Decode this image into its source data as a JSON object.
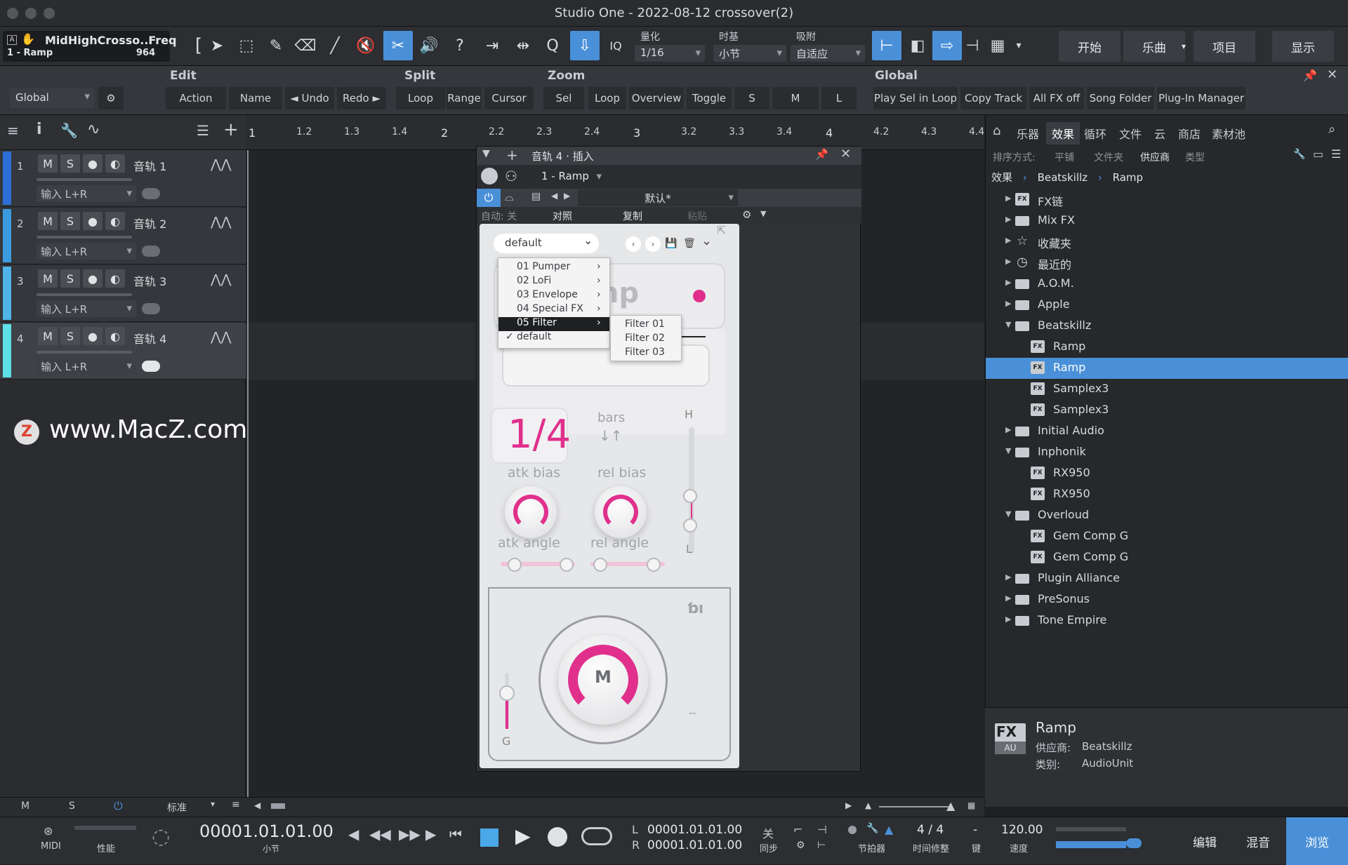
{
  "window": {
    "title": "Studio One - 2022-08-12 crossover(2)"
  },
  "toolbar": {
    "track_name": "MidHighCrosso..Freq",
    "track_sub": "1 - Ramp",
    "track_value": "964",
    "iq": "IQ",
    "quantize_label": "量化",
    "quantize_value": "1/16",
    "timebase_label": "时基",
    "timebase_value": "小节",
    "snap_label": "吸附",
    "snap_value": "自适应",
    "nav": [
      "开始",
      "乐曲",
      "项目",
      "显示"
    ]
  },
  "macro": {
    "groups": [
      "Edit",
      "Split",
      "Zoom",
      "Global"
    ],
    "global_select": "Global",
    "buttons": [
      "Action",
      "Name",
      "◄ Undo",
      "Redo ►",
      "Loop",
      "Range",
      "Cursor",
      "Sel",
      "Loop",
      "Overview",
      "Toggle",
      "S",
      "M",
      "L",
      "Play Sel in Loop",
      "Copy Track",
      "All FX off",
      "Song Folder",
      "Plug-In Manager"
    ]
  },
  "tracks": [
    {
      "num": "1",
      "name": "音轨 1",
      "input": "输入 L+R",
      "color": "#2d6fd6"
    },
    {
      "num": "2",
      "name": "音轨 2",
      "input": "输入 L+R",
      "color": "#3b9be0"
    },
    {
      "num": "3",
      "name": "音轨 3",
      "input": "输入 L+R",
      "color": "#4fb4e8"
    },
    {
      "num": "4",
      "name": "音轨 4",
      "input": "输入 L+R",
      "color": "#5fe0e8"
    }
  ],
  "track_buttons": {
    "m": "M",
    "s": "S"
  },
  "ruler": {
    "ticks": [
      "1",
      "1.2",
      "1.3",
      "1.4",
      "2",
      "2.2",
      "2.3",
      "2.4",
      "3",
      "3.2",
      "3.3",
      "3.4",
      "4",
      "4.2",
      "4.3",
      "4.4"
    ]
  },
  "watermark": {
    "text": "www.MacZ.com",
    "badge": "Z"
  },
  "plugin": {
    "title": "音轨 4 · 插入",
    "slot": "1 - Ramp",
    "preset": "默认*",
    "auto": "自动: 关",
    "compare": "对照",
    "copy": "复制",
    "paste": "粘贴",
    "preset_dropdown": "default",
    "menu_items": [
      "01 Pumper",
      "02 LoFi",
      "03 Envelope",
      "04 Special FX",
      "05 Filter",
      "default"
    ],
    "submenu_items": [
      "Filter 01",
      "Filter 02",
      "Filter 03"
    ],
    "rate": "1/4",
    "bars": "bars",
    "bars_arrows": "↓↑",
    "atk_bias": "atk bias",
    "rel_bias": "rel bias",
    "atk_angle": "atk angle",
    "rel_angle": "rel angle",
    "h": "H",
    "l": "L",
    "g": "G",
    "m": "M",
    "dash": "--",
    "logo_partial": "np"
  },
  "browser": {
    "tabs": [
      "乐器",
      "效果",
      "循环",
      "文件",
      "云",
      "商店",
      "素材池"
    ],
    "active_tab": "效果",
    "sort_label": "排序方式:",
    "sort_options": [
      "平铺",
      "文件夹",
      "供应商",
      "类型"
    ],
    "breadcrumb": [
      "效果",
      "Beatskillz",
      "Ramp"
    ],
    "items": [
      {
        "label": "FX链",
        "kind": "fx",
        "indent": 0,
        "arrow": "▶"
      },
      {
        "label": "Mix FX",
        "kind": "folder",
        "indent": 0,
        "arrow": "▶"
      },
      {
        "label": "收藏夹",
        "kind": "star",
        "indent": 0,
        "arrow": "▶"
      },
      {
        "label": "最近的",
        "kind": "clock",
        "indent": 0,
        "arrow": "▶"
      },
      {
        "label": "A.O.M.",
        "kind": "folder",
        "indent": 0,
        "arrow": "▶"
      },
      {
        "label": "Apple",
        "kind": "folder",
        "indent": 0,
        "arrow": "▶"
      },
      {
        "label": "Beatskillz",
        "kind": "folder",
        "indent": 0,
        "arrow": "▼"
      },
      {
        "label": "Ramp",
        "kind": "fx",
        "indent": 1,
        "arrow": ""
      },
      {
        "label": "Ramp",
        "kind": "fx",
        "indent": 1,
        "arrow": "",
        "selected": true
      },
      {
        "label": "Samplex3",
        "kind": "fx",
        "indent": 1,
        "arrow": ""
      },
      {
        "label": "Samplex3",
        "kind": "fx",
        "indent": 1,
        "arrow": ""
      },
      {
        "label": "Initial Audio",
        "kind": "folder",
        "indent": 0,
        "arrow": "▶"
      },
      {
        "label": "Inphonik",
        "kind": "folder",
        "indent": 0,
        "arrow": "▼"
      },
      {
        "label": "RX950",
        "kind": "fx",
        "indent": 1,
        "arrow": ""
      },
      {
        "label": "RX950",
        "kind": "fx",
        "indent": 1,
        "arrow": ""
      },
      {
        "label": "Overloud",
        "kind": "folder",
        "indent": 0,
        "arrow": "▼"
      },
      {
        "label": "Gem Comp G",
        "kind": "fx",
        "indent": 1,
        "arrow": ""
      },
      {
        "label": "Gem Comp G",
        "kind": "fx",
        "indent": 1,
        "arrow": ""
      },
      {
        "label": "Plugin Alliance",
        "kind": "folder",
        "indent": 0,
        "arrow": "▶"
      },
      {
        "label": "PreSonus",
        "kind": "folder",
        "indent": 0,
        "arrow": "▶"
      },
      {
        "label": "Tone Empire",
        "kind": "folder",
        "indent": 0,
        "arrow": "▶"
      }
    ],
    "info": {
      "name": "Ramp",
      "vendor_label": "供应商:",
      "vendor": "Beatskillz",
      "type_label": "类别:",
      "type": "AudioUnit",
      "fx": "FX",
      "au": "AU"
    }
  },
  "statusbar": {
    "m": "M",
    "s": "S",
    "mode": "标准"
  },
  "transport": {
    "midi": "MIDI",
    "perf": "性能",
    "position": "00001.01.01.00",
    "position_unit": "小节",
    "left_label": "L",
    "right_label": "R",
    "left_loc": "00001.01.01.00",
    "right_loc": "00001.01.01.00",
    "sync_state": "关",
    "sync_label": "同步",
    "metronome": "节拍器",
    "time_sig": "4 / 4",
    "time_sig_label": "时间修整",
    "key": "-",
    "key_label": "键",
    "tempo": "120.00",
    "tempo_label": "速度",
    "side": [
      "编辑",
      "混音",
      "浏览"
    ]
  }
}
